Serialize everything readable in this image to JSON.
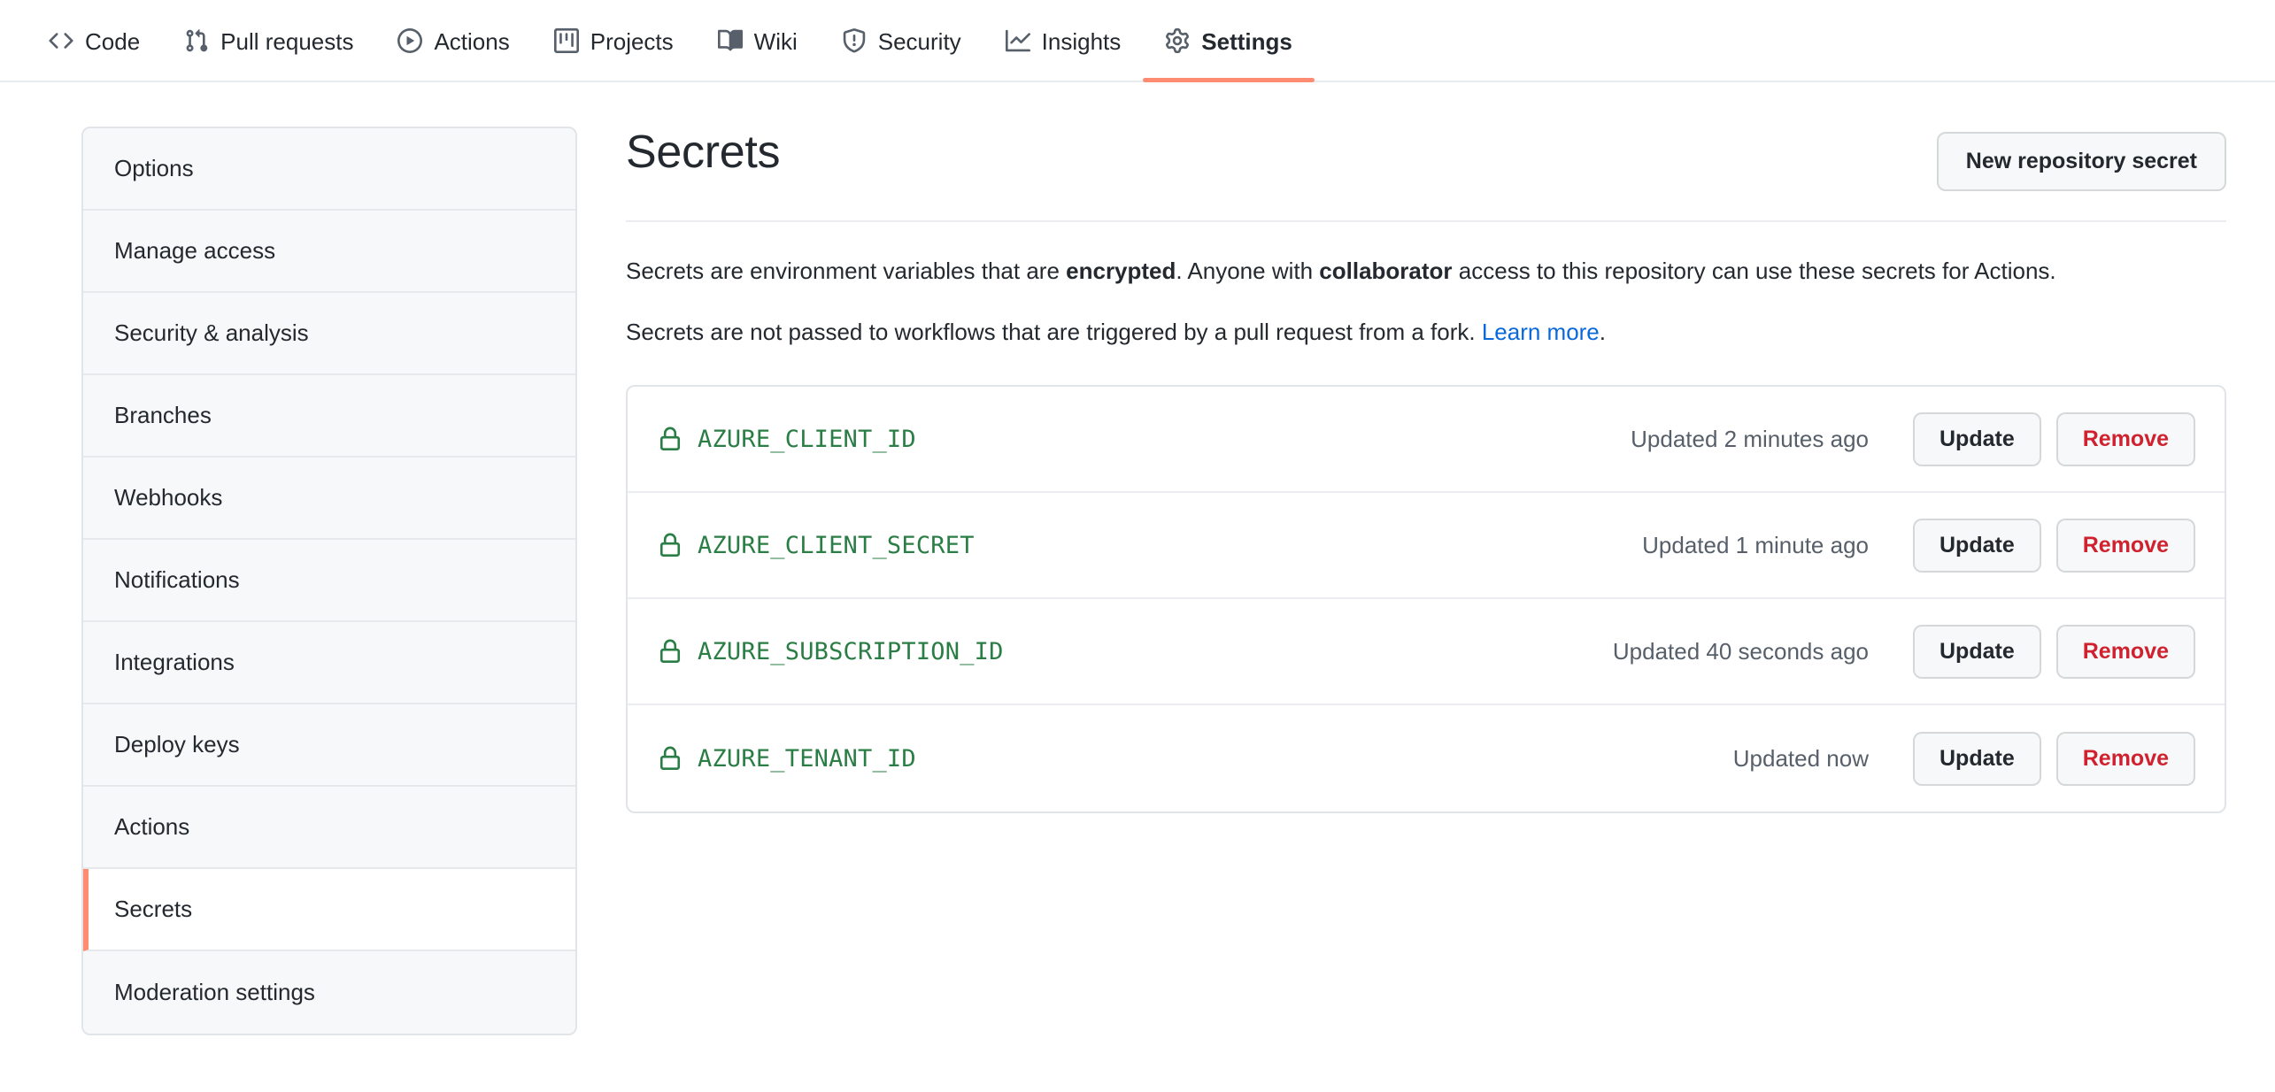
{
  "repo_nav": {
    "items": [
      {
        "label": "Code",
        "icon": "code-icon",
        "active": false
      },
      {
        "label": "Pull requests",
        "icon": "git-pull-request-icon",
        "active": false
      },
      {
        "label": "Actions",
        "icon": "play-icon",
        "active": false
      },
      {
        "label": "Projects",
        "icon": "project-board-icon",
        "active": false
      },
      {
        "label": "Wiki",
        "icon": "book-icon",
        "active": false
      },
      {
        "label": "Security",
        "icon": "shield-icon",
        "active": false
      },
      {
        "label": "Insights",
        "icon": "graph-icon",
        "active": false
      },
      {
        "label": "Settings",
        "icon": "gear-icon",
        "active": true
      }
    ]
  },
  "sidebar": {
    "items": [
      {
        "label": "Options",
        "active": false
      },
      {
        "label": "Manage access",
        "active": false
      },
      {
        "label": "Security & analysis",
        "active": false
      },
      {
        "label": "Branches",
        "active": false
      },
      {
        "label": "Webhooks",
        "active": false
      },
      {
        "label": "Notifications",
        "active": false
      },
      {
        "label": "Integrations",
        "active": false
      },
      {
        "label": "Deploy keys",
        "active": false
      },
      {
        "label": "Actions",
        "active": false
      },
      {
        "label": "Secrets",
        "active": true
      },
      {
        "label": "Moderation settings",
        "active": false
      }
    ]
  },
  "main": {
    "title": "Secrets",
    "new_secret_button": "New repository secret",
    "description_1": {
      "part_1": "Secrets are environment variables that are ",
      "bold_1": "encrypted",
      "part_2": ". Anyone with ",
      "bold_2": "collaborator",
      "part_3": " access to this repository can use these secrets for Actions."
    },
    "description_2": {
      "part_1": "Secrets are not passed to workflows that are triggered by a pull request from a fork. ",
      "link": "Learn more",
      "part_2": "."
    },
    "row_actions": {
      "update_label": "Update",
      "remove_label": "Remove"
    },
    "secrets": [
      {
        "name": "AZURE_CLIENT_ID",
        "updated": "Updated 2 minutes ago"
      },
      {
        "name": "AZURE_CLIENT_SECRET",
        "updated": "Updated 1 minute ago"
      },
      {
        "name": "AZURE_SUBSCRIPTION_ID",
        "updated": "Updated 40 seconds ago"
      },
      {
        "name": "AZURE_TENANT_ID",
        "updated": "Updated now"
      }
    ]
  },
  "colors": {
    "accent_orange": "#fd8c73",
    "secret_green": "#2a7d45",
    "remove_red": "#cf222e",
    "link_blue": "#0969da",
    "muted_text": "#57606a",
    "panel_gray": "#f6f8fa",
    "border_gray": "#e1e4e8"
  }
}
